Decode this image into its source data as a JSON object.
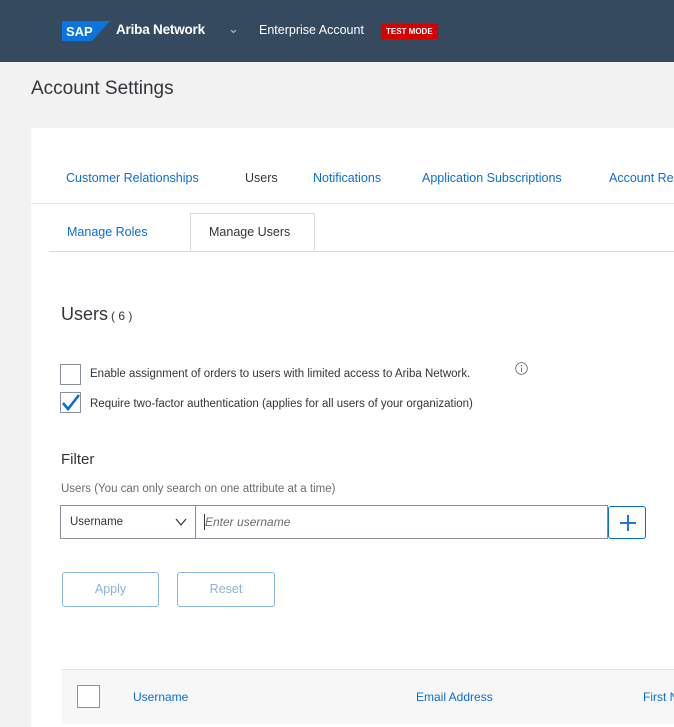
{
  "header": {
    "logo": "SAP",
    "product": "Ariba Network",
    "account_type": "Enterprise Account",
    "mode_badge": "TEST MODE",
    "colors": {
      "bar": "#354a5f",
      "badge": "#d40000",
      "link": "#0a6ed1"
    }
  },
  "page": {
    "title": "Account Settings"
  },
  "tabs": [
    {
      "label": "Customer Relationships",
      "active": false
    },
    {
      "label": "Users",
      "active": true
    },
    {
      "label": "Notifications",
      "active": false
    },
    {
      "label": "Application Subscriptions",
      "active": false
    },
    {
      "label": "Account Re",
      "active": false
    }
  ],
  "subtabs": [
    {
      "label": "Manage Roles",
      "active": false
    },
    {
      "label": "Manage Users",
      "active": true
    }
  ],
  "users": {
    "heading": "Users",
    "count": "( 6 )"
  },
  "options": [
    {
      "label": "Enable assignment of orders to users with limited access to Ariba Network.",
      "checked": false,
      "icon": "info-icon"
    },
    {
      "label": "Require two-factor authentication (applies for all users of your organization)",
      "checked": true
    }
  ],
  "filter": {
    "title": "Filter",
    "hint": "Users (You can only search on one attribute at a time)",
    "attribute": "Username",
    "placeholder": "Enter username",
    "value": "",
    "add_icon": "plus-icon",
    "apply_label": "Apply",
    "reset_label": "Reset"
  },
  "table": {
    "columns": [
      "Username",
      "Email Address",
      "First N"
    ]
  }
}
